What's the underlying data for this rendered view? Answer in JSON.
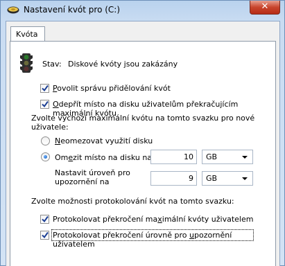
{
  "window": {
    "title": "Nastavení kvót pro  (C:)",
    "close_glyph": "✕"
  },
  "tabs": [
    {
      "label": "Kvóta",
      "selected": true
    }
  ],
  "status": {
    "label": "Stav:",
    "value": "Diskové kvóty jsou zakázány",
    "icon": "traffic-light-icon"
  },
  "options": {
    "enable_quota": {
      "pre": "",
      "key": "P",
      "post": "ovolit správu přidělování kvót",
      "checked": true
    },
    "deny_space": {
      "pre": "",
      "key": "O",
      "post": "depřít místo na disku uživatelům překračujícím maximální kvótu",
      "checked": true
    }
  },
  "default_quota": {
    "heading_line1": "Zvolte výchozí maximální kvótu na tomto svazku pro nové",
    "heading_line2": "uživatele:",
    "no_limit": {
      "pre": "",
      "key": "N",
      "post": "eomezovat využití disku",
      "selected": false
    },
    "limit": {
      "pre": "Om",
      "key": "e",
      "post": "zit místo na disku na",
      "selected": true,
      "value": "10",
      "unit": "GB"
    },
    "warning": {
      "line1": "Nastavit úroveň pro",
      "line2": "upozornění na",
      "value": "9",
      "unit": "GB"
    }
  },
  "logging": {
    "heading": "Zvolte možnosti protokolování kvót na tomto svazku:",
    "log_limit": {
      "pre": "Protokolovat překročení ma",
      "key": "x",
      "post": "imální kvóty uživatelem",
      "checked": true
    },
    "log_warning": {
      "pre": "Protokolovat překročení úrovně pro ",
      "key": "u",
      "post": "pozornění uživatelem",
      "checked": true
    }
  }
}
